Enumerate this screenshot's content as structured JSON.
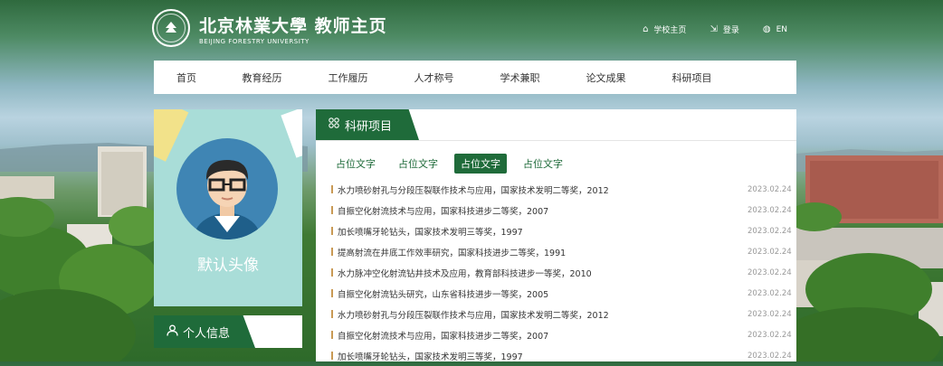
{
  "header": {
    "title": "北京林業大學 教师主页",
    "subtitle": "BEIJING FORESTRY UNIVERSITY",
    "links": [
      {
        "icon": "home-icon",
        "label": "学校主页"
      },
      {
        "icon": "login-icon",
        "label": "登录"
      },
      {
        "icon": "globe-icon",
        "label": "EN"
      }
    ]
  },
  "nav": [
    "首页",
    "教育经历",
    "工作履历",
    "人才称号",
    "学术兼职",
    "论文成果",
    "科研项目"
  ],
  "profile": {
    "avatar_label": "默认头像",
    "info_title": "个人信息"
  },
  "section": {
    "title": "科研项目",
    "filters": [
      {
        "label": "占位文字",
        "active": false
      },
      {
        "label": "占位文字",
        "active": false
      },
      {
        "label": "占位文字",
        "active": true
      },
      {
        "label": "占位文字",
        "active": false
      }
    ],
    "items": [
      {
        "title": "水力喷砂射孔与分段压裂联作技术与应用，国家技术发明二等奖，2012",
        "date": "2023.02.24"
      },
      {
        "title": "自振空化射流技术与应用，国家科技进步二等奖，2007",
        "date": "2023.02.24"
      },
      {
        "title": "加长喷嘴牙轮钻头，国家技术发明三等奖，1997",
        "date": "2023.02.24"
      },
      {
        "title": "提高射流在井底工作效率研究，国家科技进步二等奖，1991",
        "date": "2023.02.24"
      },
      {
        "title": "水力脉冲空化射流钻井技术及应用，教育部科技进步一等奖，2010",
        "date": "2023.02.24"
      },
      {
        "title": "自振空化射流钻头研究，山东省科技进步一等奖，2005",
        "date": "2023.02.24"
      },
      {
        "title": "水力喷砂射孔与分段压裂联作技术与应用，国家技术发明二等奖，2012",
        "date": "2023.02.24"
      },
      {
        "title": "自振空化射流技术与应用，国家科技进步二等奖，2007",
        "date": "2023.02.24"
      },
      {
        "title": "加长喷嘴牙轮钻头，国家技术发明三等奖，1997",
        "date": "2023.02.24"
      }
    ]
  },
  "colors": {
    "brand_green": "#1f6b3a",
    "accent_gold": "#c99a55",
    "avatar_bg": "#a9ddd8"
  }
}
